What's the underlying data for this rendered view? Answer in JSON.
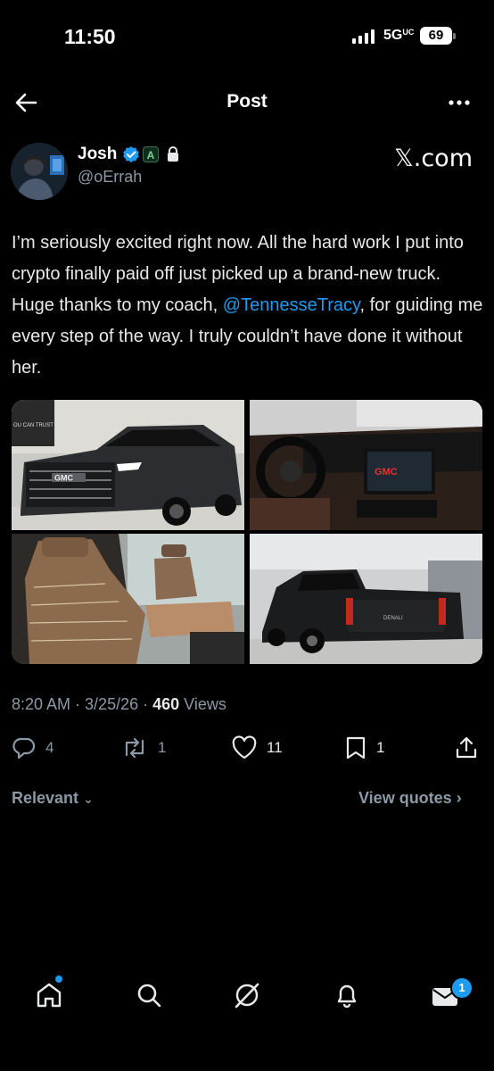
{
  "status_bar": {
    "time": "11:50",
    "network": "5G",
    "battery": "69"
  },
  "header": {
    "title": "Post",
    "back_icon": "arrow-left-icon",
    "more_icon": "more-horizontal-icon"
  },
  "author": {
    "name": "Josh",
    "handle": "@oErrah",
    "badge_letter": "A",
    "source_label": "𝕏.com"
  },
  "post": {
    "text_before": "I’m seriously excited right now. All the hard work I put into crypto finally paid off just picked up a brand-new truck. Huge thanks to my coach, ",
    "mention": "@TennesseTracy",
    "text_after": ", for guiding me every step of the way. I truly couldn’t have done it without her.",
    "photos": [
      {
        "name": "truck-front",
        "sign_text": "OU CAN TRUST",
        "grille_text": "GMC"
      },
      {
        "name": "dashboard",
        "logo_text": "GMC"
      },
      {
        "name": "leather-seats"
      },
      {
        "name": "truck-rear",
        "tailgate_text": "DENALI"
      }
    ]
  },
  "meta": {
    "time": "8:20 AM",
    "sep1": " · ",
    "date": "3/25/26",
    "sep2": " · ",
    "views_count": "460",
    "views_label": " Views"
  },
  "actions": {
    "replies": "4",
    "reposts": "1",
    "likes": "11",
    "bookmarks": "1"
  },
  "replies_bar": {
    "sort_label": "Relevant",
    "view_quotes": "View quotes"
  },
  "bottom_nav": {
    "items": [
      "home-icon",
      "search-icon",
      "grok-icon",
      "notifications-icon",
      "messages-icon"
    ],
    "messages_badge": "1"
  },
  "colors": {
    "accent": "#1d9bf0",
    "muted": "#8b98a5",
    "background": "#000000"
  }
}
